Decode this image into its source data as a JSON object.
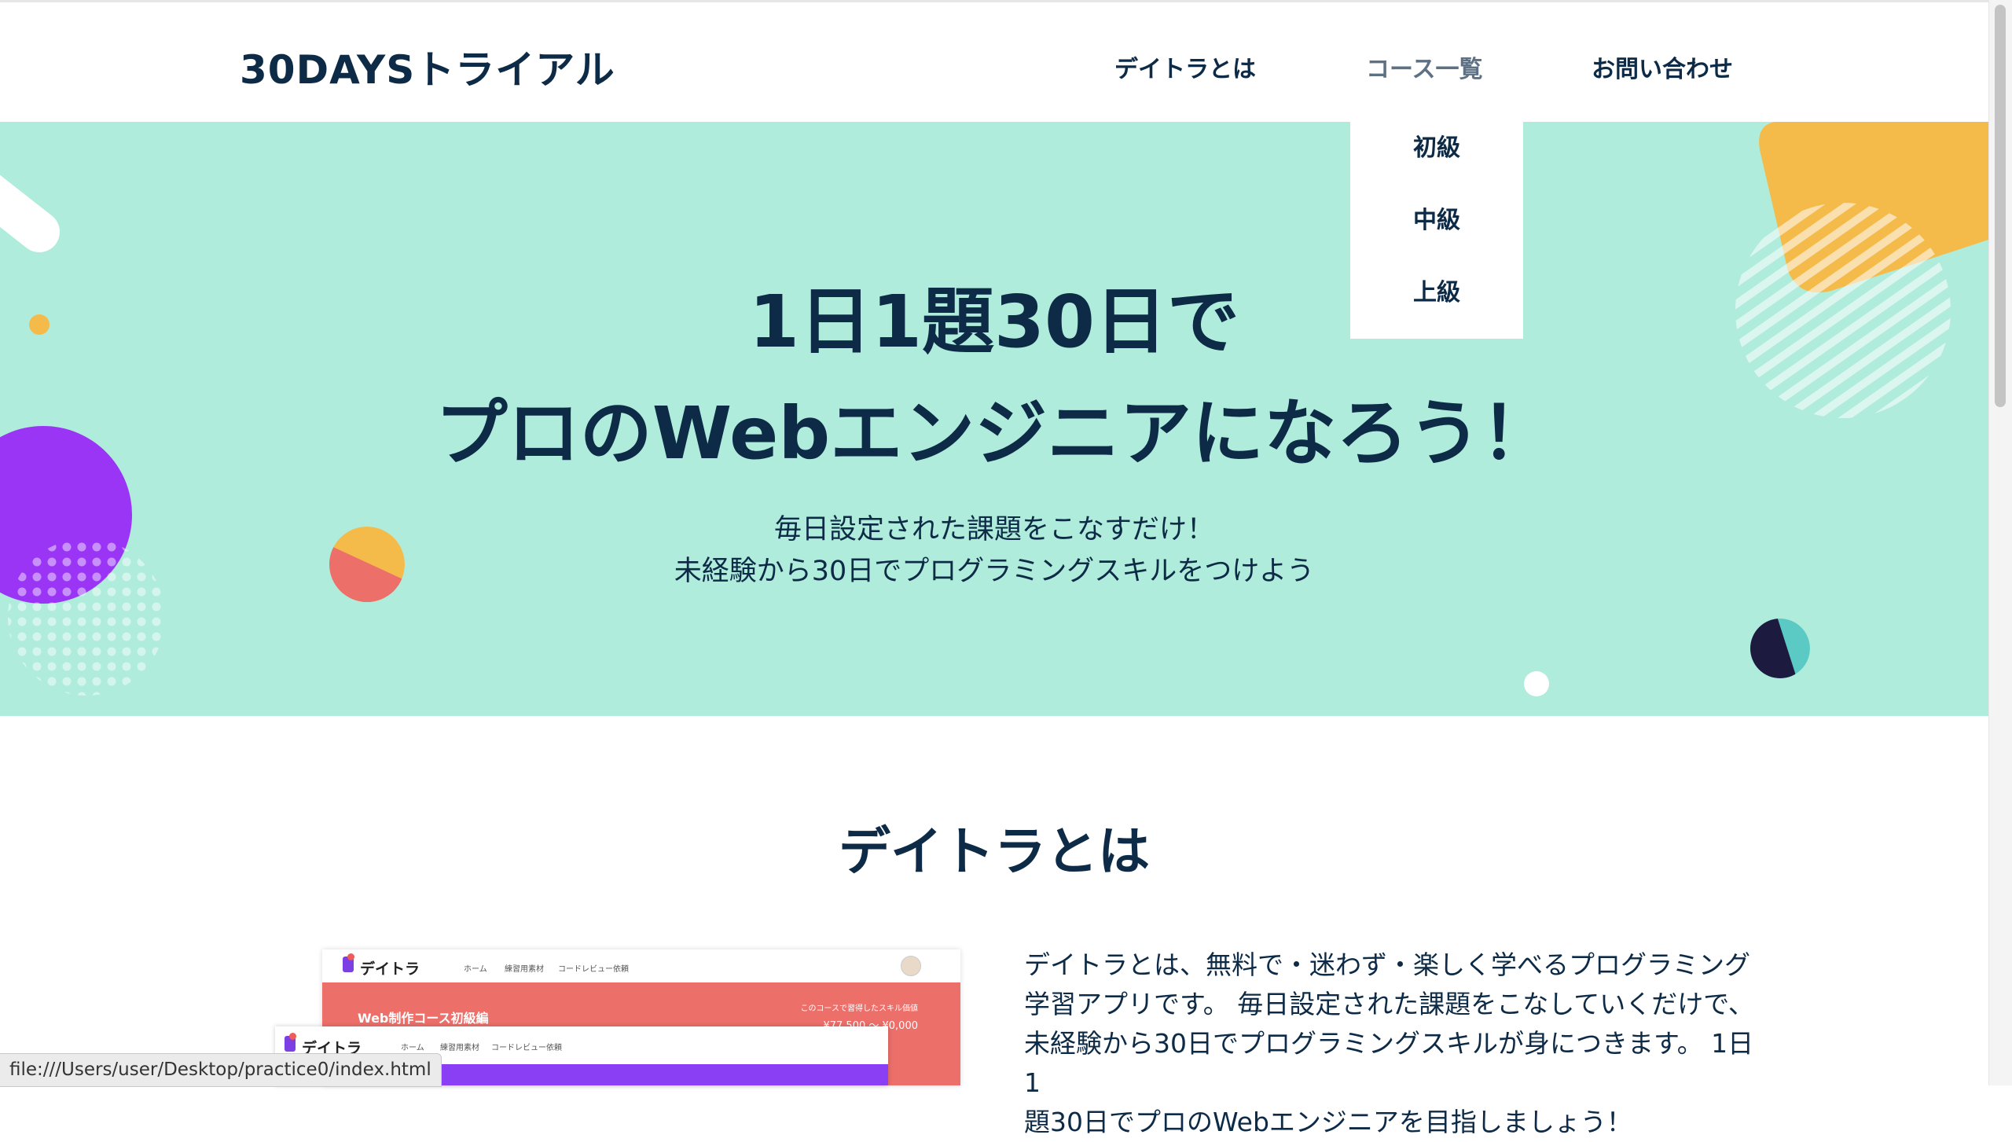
{
  "header": {
    "logo": "30DAYSトライアル",
    "nav": [
      {
        "label": "デイトラとは"
      },
      {
        "label": "コース一覧"
      },
      {
        "label": "お問い合わせ"
      }
    ]
  },
  "dropdown": {
    "items": [
      "初級",
      "中級",
      "上級"
    ]
  },
  "hero": {
    "title_line1": "1日1題30日で",
    "title_line2": "プロのWebエンジニアになろう！",
    "sub_line1": "毎日設定された課題をこなすだけ！",
    "sub_line2": "未経験から30日でプログラミングスキルをつけよう"
  },
  "about": {
    "title": "デイトラとは",
    "lines": [
      "デイトラとは、無料で・迷わず・楽しく学べるプログラミング",
      "学習アプリです。 毎日設定された課題をこなしていくだけで、",
      "未経験から30日でプログラミングスキルが身につきます。 1日1",
      "題30日でプロのWebエンジニアを目指しましょう！"
    ]
  },
  "mockup": {
    "logo": "デイトラ",
    "links": [
      "ホーム",
      "練習用素材",
      "コードレビュー依頼"
    ],
    "banner_title": "Web制作コース初級編",
    "banner_note": "このコースで習得したスキル価値",
    "banner_price": "¥77,500 〜 ¥0,000"
  },
  "statusbar": {
    "url": "file:///Users/user/Desktop/practice0/index.html"
  },
  "colors": {
    "hero_bg": "#b0ecdb",
    "text_navy": "#0d2a46",
    "purple": "#9b35f5",
    "orange": "#f4bb4b",
    "coral": "#ec6f6a",
    "teal": "#5ccac4",
    "dark_navy": "#1c1a3f"
  }
}
